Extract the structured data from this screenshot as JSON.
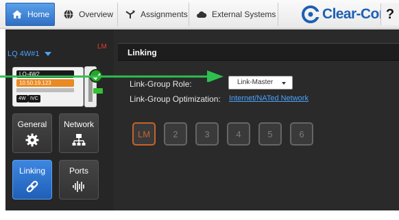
{
  "nav": {
    "tabs": [
      {
        "label": "Home",
        "icon": "home-icon",
        "active": true
      },
      {
        "label": "Overview",
        "icon": "globe-icon"
      },
      {
        "label": "Assignments",
        "icon": "fork-icon"
      },
      {
        "label": "External Systems",
        "icon": "cloud-icon"
      }
    ],
    "brand": "Clear-Com",
    "help_label": "?"
  },
  "sidebar": {
    "device_name": "LQ 4W#1",
    "status_tag": "LM",
    "device_card": {
      "model": "LQ-4W2",
      "ip": "10.50.19.123",
      "chips": [
        "4W",
        "IVC"
      ]
    },
    "nav_buttons": [
      {
        "label": "General",
        "icon": "gear-icon"
      },
      {
        "label": "Network",
        "icon": "network-icon"
      },
      {
        "label": "Linking",
        "icon": "link-icon",
        "active": true
      },
      {
        "label": "Ports",
        "icon": "audio-wave-icon"
      }
    ]
  },
  "main": {
    "title": "Linking",
    "link_group_role_label": "Link-Group Role:",
    "link_group_role_value": "Link-Master",
    "link_group_optimization_label": "Link-Group Optimization:",
    "link_group_optimization_value": "Internet/NATed Network",
    "link_slots": [
      "LM",
      "2",
      "3",
      "4",
      "5",
      "6"
    ]
  },
  "colors": {
    "accent": "#2f6fc4",
    "link_text": "#4aa3ff",
    "lm_slot": "#c7632a",
    "annotation_arrow": "#2fbf4f"
  }
}
